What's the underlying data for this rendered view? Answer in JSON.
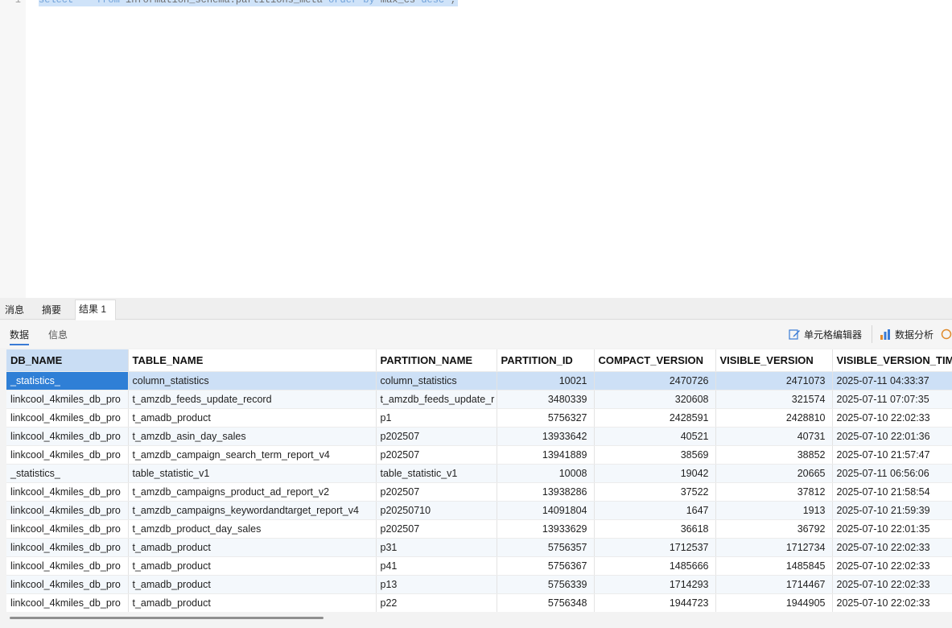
{
  "editor": {
    "line_number": "1",
    "sql": [
      {
        "t": "select",
        "kw": true
      },
      {
        "t": "  * ",
        "kw": false
      },
      {
        "t": "from",
        "kw": true
      },
      {
        "t": " information_schema.partitions_meta ",
        "kw": false
      },
      {
        "t": "order by",
        "kw": true
      },
      {
        "t": " max_cs ",
        "kw": false
      },
      {
        "t": "desc",
        "kw": true
      },
      {
        "t": " ;",
        "kw": false
      }
    ]
  },
  "tabs": {
    "messages": "消息",
    "summary": "摘要",
    "result": "结果 1"
  },
  "subtabs": {
    "data": "数据",
    "info": "信息"
  },
  "toolbar": {
    "cell_editor": "单元格编辑器",
    "data_analysis": "数据分析"
  },
  "columns": [
    "DB_NAME",
    "TABLE_NAME",
    "PARTITION_NAME",
    "PARTITION_ID",
    "COMPACT_VERSION",
    "VISIBLE_VERSION",
    "VISIBLE_VERSION_TIME"
  ],
  "rows": [
    [
      "_statistics_",
      "column_statistics",
      "column_statistics",
      "10021",
      "2470726",
      "2471073",
      "2025-07-11 04:33:37"
    ],
    [
      "linkcool_4kmiles_db_pro",
      "t_amzdb_feeds_update_record",
      "t_amzdb_feeds_update_r",
      "3480339",
      "320608",
      "321574",
      "2025-07-11 07:07:35"
    ],
    [
      "linkcool_4kmiles_db_pro",
      "t_amadb_product",
      "p1",
      "5756327",
      "2428591",
      "2428810",
      "2025-07-10 22:02:33"
    ],
    [
      "linkcool_4kmiles_db_pro",
      "t_amzdb_asin_day_sales",
      "p202507",
      "13933642",
      "40521",
      "40731",
      "2025-07-10 22:01:36"
    ],
    [
      "linkcool_4kmiles_db_pro",
      "t_amzdb_campaign_search_term_report_v4",
      "p202507",
      "13941889",
      "38569",
      "38852",
      "2025-07-10 21:57:47"
    ],
    [
      "_statistics_",
      "table_statistic_v1",
      "table_statistic_v1",
      "10008",
      "19042",
      "20665",
      "2025-07-11 06:56:06"
    ],
    [
      "linkcool_4kmiles_db_pro",
      "t_amzdb_campaigns_product_ad_report_v2",
      "p202507",
      "13938286",
      "37522",
      "37812",
      "2025-07-10 21:58:54"
    ],
    [
      "linkcool_4kmiles_db_pro",
      "t_amzdb_campaigns_keywordandtarget_report_v4",
      "p20250710",
      "14091804",
      "1647",
      "1913",
      "2025-07-10 21:59:39"
    ],
    [
      "linkcool_4kmiles_db_pro",
      "t_amzdb_product_day_sales",
      "p202507",
      "13933629",
      "36618",
      "36792",
      "2025-07-10 22:01:35"
    ],
    [
      "linkcool_4kmiles_db_pro",
      "t_amadb_product",
      "p31",
      "5756357",
      "1712537",
      "1712734",
      "2025-07-10 22:02:33"
    ],
    [
      "linkcool_4kmiles_db_pro",
      "t_amadb_product",
      "p41",
      "5756367",
      "1485666",
      "1485845",
      "2025-07-10 22:02:33"
    ],
    [
      "linkcool_4kmiles_db_pro",
      "t_amadb_product",
      "p13",
      "5756339",
      "1714293",
      "1714467",
      "2025-07-10 22:02:33"
    ],
    [
      "linkcool_4kmiles_db_pro",
      "t_amadb_product",
      "p22",
      "5756348",
      "1944723",
      "1944905",
      "2025-07-10 22:02:33"
    ]
  ],
  "colors": {
    "selection": "#cde0f6",
    "current_cell": "#2f7fd6",
    "alt_row": "#f4f8fc"
  }
}
